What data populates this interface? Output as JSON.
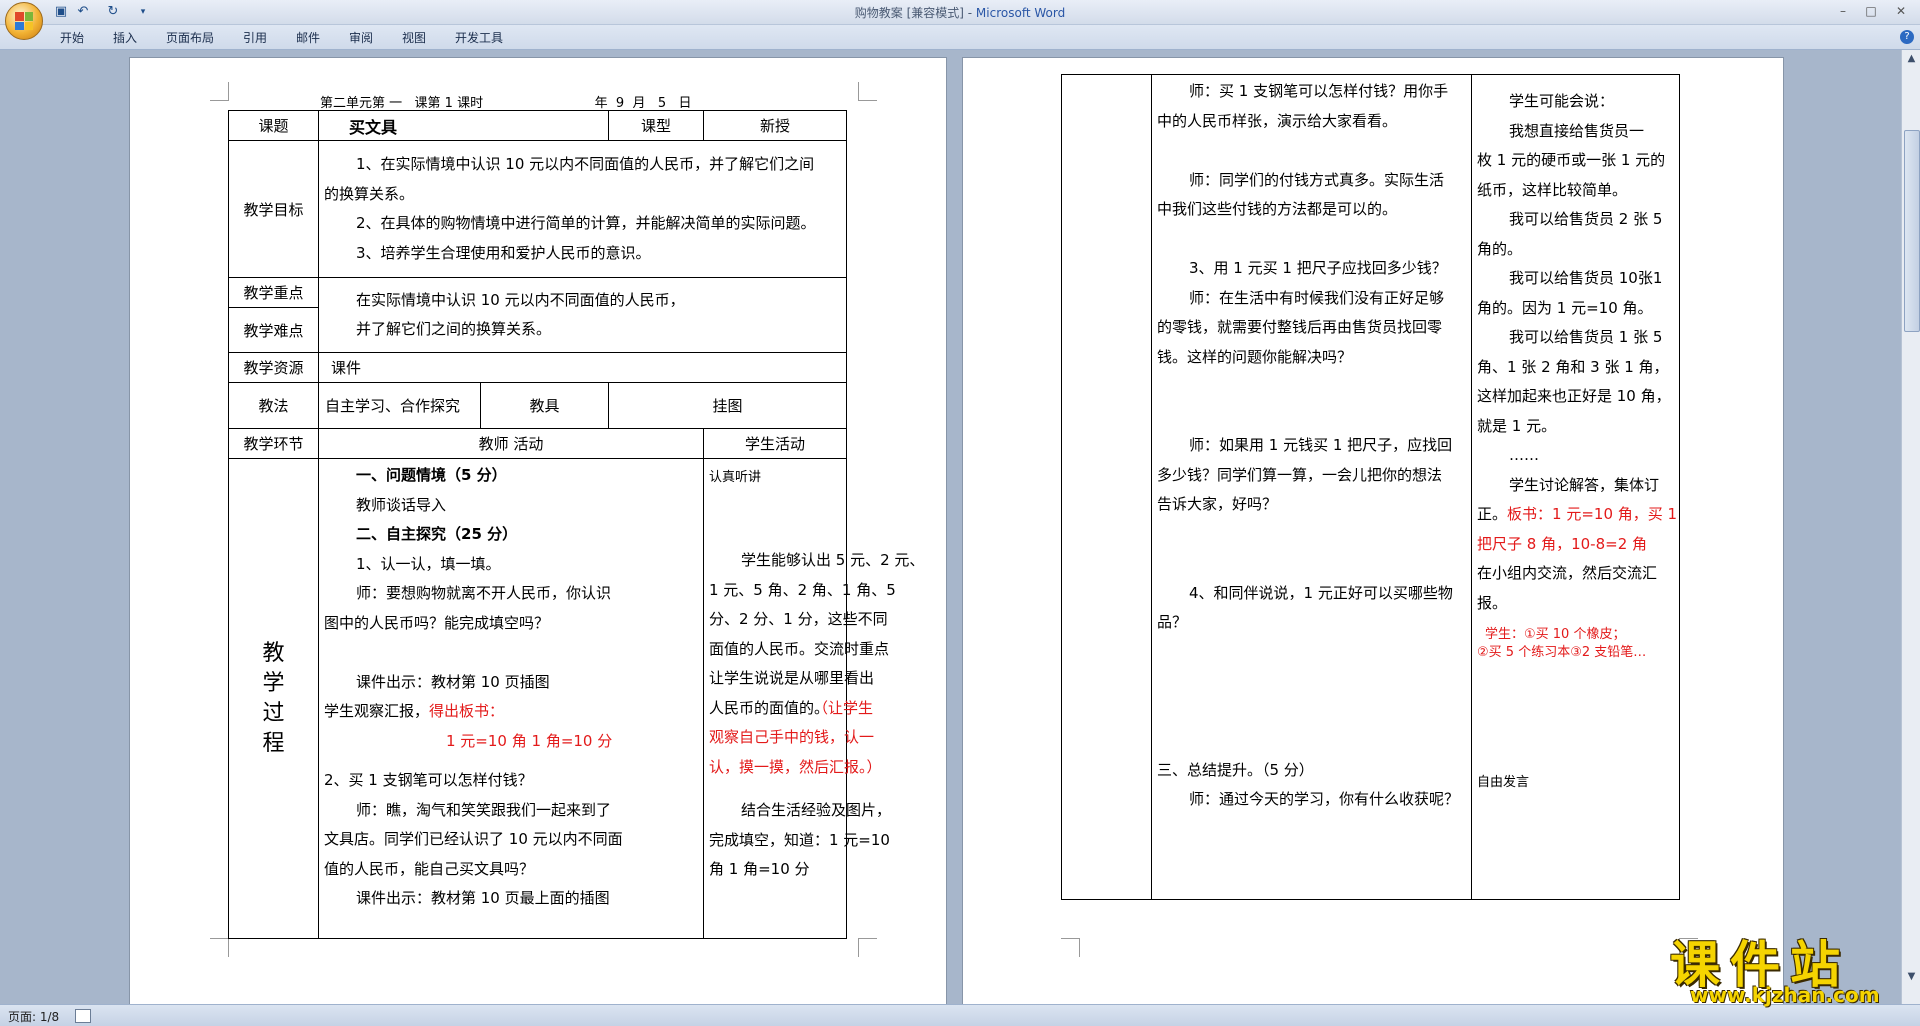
{
  "window": {
    "title": "购物教案 [兼容模式] - ",
    "app_name": "Microsoft Word",
    "controls": [
      "–",
      "□",
      "✕"
    ]
  },
  "quick_access": [
    "save-icon",
    "undo-icon",
    "redo-icon",
    "customize-icon"
  ],
  "ribbon_tabs": [
    "开始",
    "插入",
    "页面布局",
    "引用",
    "邮件",
    "审阅",
    "视图",
    "开发工具"
  ],
  "status": {
    "page": "页面: 1/8"
  },
  "watermark": {
    "main": "课件站",
    "url": "www.kjzhan.com"
  },
  "left_page": {
    "header": "第二单元第 一   课第 1 课时                           年  9  月   5   日",
    "title_label": "课题",
    "title_value": "买文具",
    "type_label": "课型",
    "type_value": "新授",
    "goals_label": "教学目标",
    "goals": [
      "1、在实际情境中认识 10 元以内不同面值的人民币，并了解它们之间",
      "的换算关系。",
      "2、在具体的购物情境中进行简单的计算，并能解决简单的实际问题。",
      "3、培养学生合理使用和爱护人民币的意识。"
    ],
    "key_label": "教学重点",
    "difficulty_label": "教学难点",
    "key_text": [
      "在实际情境中认识 10 元以内不同面值的人民币，",
      "并了解它们之间的换算关系。"
    ],
    "resource_label": "教学资源",
    "resource_value": "课件",
    "method_label": "教法",
    "method_value": "自主学习、合作探究",
    "tools_label": "教具",
    "tools_value": "挂图",
    "stage_label": "教学环节",
    "teacher_label": "教师 活动",
    "student_label": "学生活动",
    "process_label": [
      "教",
      "学",
      "过",
      "程"
    ],
    "teacher_lines": [
      {
        "t": "一、问题情境（5 分）",
        "cls": "ind bold"
      },
      {
        "t": "教师谈话导入",
        "cls": "ind"
      },
      {
        "t": "二、自主探究（25 分）",
        "cls": "ind bold"
      },
      {
        "t": "1、认一认，填一填。",
        "cls": "ind"
      },
      {
        "t": "师：要想购物就离不开人民币，你认识",
        "cls": "ind"
      },
      {
        "t": "图中的人民币吗？能完成填空吗？",
        "cls": ""
      },
      {
        "t": "",
        "cls": ""
      },
      {
        "t": "课件出示：教材第 10 页插图",
        "cls": "ind"
      }
    ],
    "observe_text": "学生观察汇报，",
    "observe_red": "得出板书：",
    "board_line": "1 元=10 角    1 角=10 分",
    "teacher_lines2": [
      {
        "t": "2、买 1 支钢笔可以怎样付钱？",
        "cls": ""
      },
      {
        "t": "师：瞧，淘气和笑笑跟我们一起来到了",
        "cls": "ind"
      },
      {
        "t": "文具店。同学们已经认识了 10 元以内不同面",
        "cls": ""
      },
      {
        "t": "值的人民币，能自己买文具吗？",
        "cls": ""
      },
      {
        "t": "课件出示：教材第 10 页最上面的插图",
        "cls": "ind"
      }
    ],
    "student_lines": [
      {
        "t": "认真听讲",
        "cls": "small"
      },
      {
        "t": "",
        "cls": ""
      },
      {
        "t": "",
        "cls": ""
      },
      {
        "t": "学生能够认出 5 元、2 元、",
        "cls": "ind"
      },
      {
        "t": "1 元、5 角、2 角、1 角、5",
        "cls": ""
      },
      {
        "t": "分、2 分、1 分，这些不同",
        "cls": ""
      },
      {
        "t": "面值的人民币。交流时重点",
        "cls": ""
      },
      {
        "t": "让学生说说是从哪里看出",
        "cls": ""
      },
      {
        "t": "人民币的面值的。",
        "cls": ""
      }
    ],
    "student_red": [
      "（让学生",
      "观察自己手中的钱，认一",
      "认，摸一摸，然后汇报。）"
    ],
    "student_lines2": [
      {
        "t": "结合生活经验及图片，",
        "cls": "ind"
      },
      {
        "t": "完成填空，知道：1 元=10",
        "cls": ""
      },
      {
        "t": "角      1 角=10 分",
        "cls": ""
      }
    ]
  },
  "right_page": {
    "teacher_lines": [
      {
        "t": "师：买 1 支钢笔可以怎样付钱？用你手",
        "cls": "ind",
        "red": false
      },
      {
        "t": "中的人民币样张，演示给大家看看。",
        "cls": "",
        "red": false
      },
      {
        "t": "",
        "cls": "",
        "red": false
      },
      {
        "t": "师：同学们的付钱方式真多。实际生活",
        "cls": "ind",
        "red": false
      },
      {
        "t": "中我们这些付钱的方法都是可以的。",
        "cls": "",
        "red": false
      },
      {
        "t": "",
        "cls": "",
        "red": false
      },
      {
        "t": "3、用 1 元买 1 把尺子应找回多少钱？",
        "cls": "ind",
        "red": false
      },
      {
        "t": "师：在生活中有时候我们没有正好足够",
        "cls": "ind",
        "red": false
      },
      {
        "t": "的零钱，就需要付整钱后再由售货员找回零",
        "cls": "",
        "red": false
      },
      {
        "t": "钱。这样的问题你能解决吗？",
        "cls": "",
        "red": false
      },
      {
        "t": "",
        "cls": "",
        "red": false
      },
      {
        "t": "",
        "cls": "",
        "red": false
      },
      {
        "t": "师：如果用 1 元钱买 1 把尺子，应找回",
        "cls": "ind",
        "red": false
      },
      {
        "t": "多少钱？同学们算一算，一会儿把你的想法",
        "cls": "",
        "red": false
      },
      {
        "t": "告诉大家，好吗？",
        "cls": "",
        "red": false
      },
      {
        "t": "",
        "cls": "",
        "red": false
      },
      {
        "t": "",
        "cls": "",
        "red": false
      },
      {
        "t": "4、和同伴说说，1 元正好可以买哪些物",
        "cls": "ind",
        "red": false
      },
      {
        "t": "品？",
        "cls": "",
        "red": false
      },
      {
        "t": "",
        "cls": "",
        "red": false
      },
      {
        "t": "",
        "cls": "",
        "red": false
      },
      {
        "t": "",
        "cls": "",
        "red": false
      },
      {
        "t": "",
        "cls": "",
        "red": false
      },
      {
        "t": "三、总结提升。（5 分）",
        "cls": "",
        "red": false
      },
      {
        "t": "师：通过今天的学习，你有什么收获呢？",
        "cls": "ind",
        "red": false
      }
    ],
    "student_lines": [
      {
        "t": "学生可能会说：",
        "cls": "ind"
      },
      {
        "t": "我想直接给售货员一",
        "cls": "ind"
      },
      {
        "t": "枚 1 元的硬币或一张 1 元的",
        "cls": ""
      },
      {
        "t": "纸币，这样比较简单。",
        "cls": ""
      },
      {
        "t": "我可以给售货员 2 张 5",
        "cls": "ind"
      },
      {
        "t": "角的。",
        "cls": ""
      },
      {
        "t": "我可以给售货员 10张1",
        "cls": "ind"
      },
      {
        "t": "角的。因为 1 元=10 角。",
        "cls": ""
      },
      {
        "t": "我可以给售货员 1 张 5",
        "cls": "ind"
      },
      {
        "t": "角、1 张 2 角和 3 张 1 角，",
        "cls": ""
      },
      {
        "t": "这样加起来也正好是 10 角，",
        "cls": ""
      },
      {
        "t": "就是 1 元。",
        "cls": ""
      },
      {
        "t": "……",
        "cls": "ind"
      }
    ],
    "student_discuss": "学生讨论解答，集体订",
    "student_discuss2": "正。",
    "student_board": "板书：1 元=10 角，买 1",
    "student_board2": "把尺子 8 角，10-8=2 角",
    "student_group": [
      "在小组内交流，然后交流汇",
      "报。"
    ],
    "student_small_red": [
      "学生：①买 10 个橡皮；",
      "②买 5 个练习本③2 支铅笔…"
    ],
    "student_free": "自由发言"
  }
}
